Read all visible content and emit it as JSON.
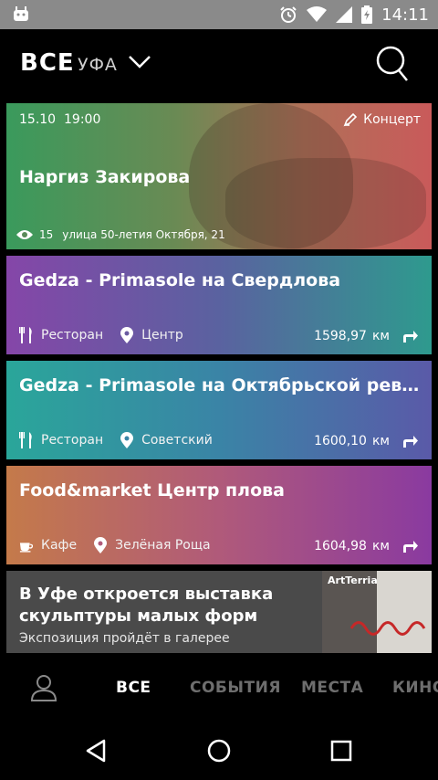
{
  "status_bar": {
    "time": "14:11"
  },
  "header": {
    "title": "ВСЕ",
    "city": "УФА"
  },
  "cards": [
    {
      "date": "15.10",
      "time": "19:00",
      "category": "Концерт",
      "title": "Наргиз Закирова",
      "views": "15",
      "address": "улица 50-летия Октября, 21"
    },
    {
      "title": "Gedza - Primasole на Свердлова",
      "type": "Ресторан",
      "district": "Центр",
      "distance": "1598,97",
      "unit": "км"
    },
    {
      "title": "Gedza - Primasole на Октябрьской револю...",
      "type": "Ресторан",
      "district": "Советский",
      "distance": "1600,10",
      "unit": "км"
    },
    {
      "title": "Food&market Центр плова",
      "type": "Кафе",
      "district": "Зелёная Роща",
      "distance": "1604,98",
      "unit": "км"
    }
  ],
  "news": {
    "title": "В Уфе откроется выставка скульптуры малых форм",
    "subtitle": "Экспозиция пройдёт в галерее",
    "thumb_label": "ArtTerria"
  },
  "bottom_nav": {
    "tabs": [
      "ВСЕ",
      "СОБЫТИЯ",
      "МЕСТА",
      "КИНО"
    ]
  }
}
